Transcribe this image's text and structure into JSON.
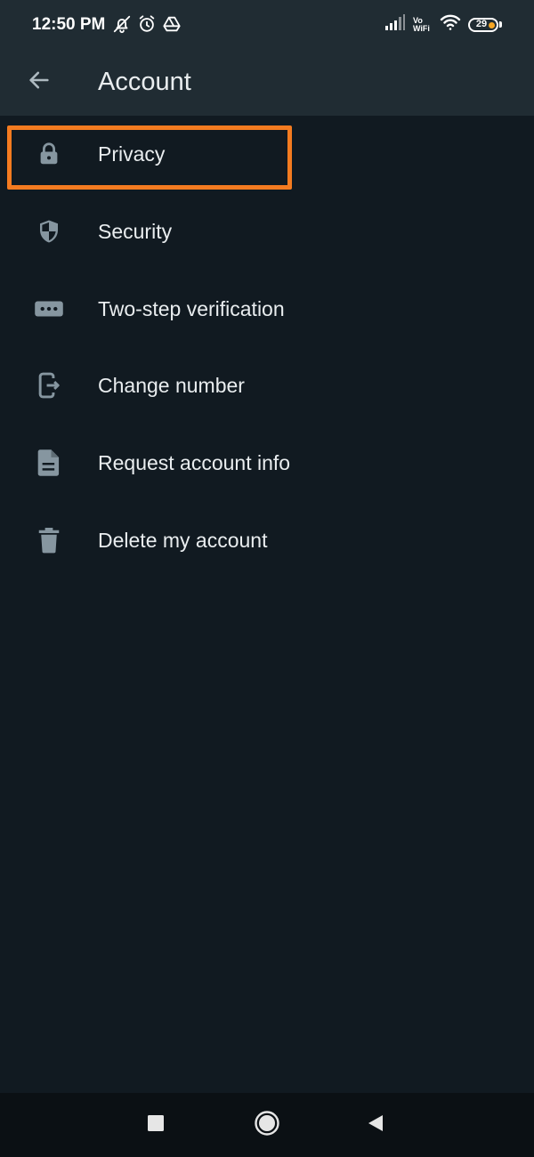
{
  "status_bar": {
    "time": "12:50 PM",
    "vowifi_top": "Vo",
    "vowifi_bottom": "WiFi",
    "battery": "29",
    "icons": [
      "bell-off-icon",
      "alarm-icon",
      "drive-icon",
      "signal-icon",
      "wifi-icon",
      "battery-icon"
    ]
  },
  "app_bar": {
    "title": "Account",
    "back_icon": "arrow-left-icon"
  },
  "menu": {
    "items": [
      {
        "label": "Privacy",
        "icon": "lock-icon"
      },
      {
        "label": "Security",
        "icon": "shield-icon"
      },
      {
        "label": "Two-step verification",
        "icon": "password-dots-icon"
      },
      {
        "label": "Change number",
        "icon": "phone-transfer-icon"
      },
      {
        "label": "Request account info",
        "icon": "document-icon"
      },
      {
        "label": "Delete my account",
        "icon": "trash-icon"
      }
    ]
  },
  "colors": {
    "background": "#111a21",
    "app_bar": "#202c33",
    "icon": "#8696a0",
    "text": "#e9edef",
    "highlight": "#f47b20"
  },
  "nav_bar": {
    "buttons": [
      "recents-square-icon",
      "home-circle-icon",
      "back-triangle-icon"
    ]
  }
}
